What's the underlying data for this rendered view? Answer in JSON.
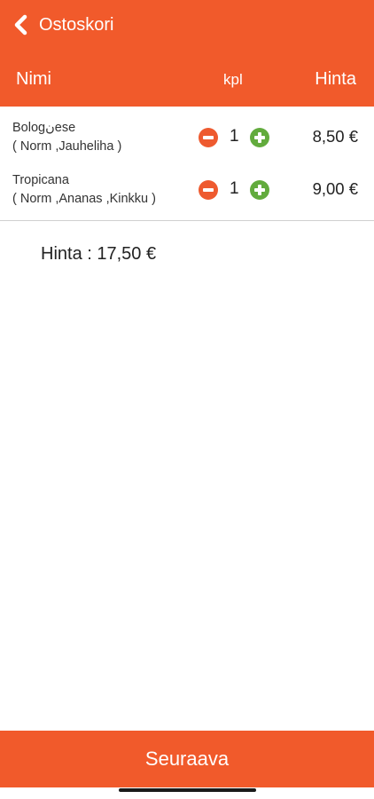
{
  "header": {
    "title": "Ostoskori",
    "back_icon": "chevron-left-icon",
    "background_color": "#F15A2B"
  },
  "columns": {
    "name": "Nimi",
    "qty": "kpl",
    "price": "Hinta"
  },
  "items": [
    {
      "name": "Bologنese",
      "options": "( Norm ,Jauheliha )",
      "qty": "1",
      "price": "8,50 €"
    },
    {
      "name": "Tropicana",
      "options": "( Norm ,Ananas ,Kinkku )",
      "qty": "1",
      "price": "9,00 €"
    }
  ],
  "icons": {
    "decrease": "minus-circle-icon",
    "increase": "plus-circle-icon",
    "decrease_color": "#EE5A2F",
    "increase_color": "#62AB3D"
  },
  "summary": {
    "total": "Hinta : 17,50 €"
  },
  "footer": {
    "next_label": "Seuraava",
    "background_color": "#F15A2B"
  }
}
